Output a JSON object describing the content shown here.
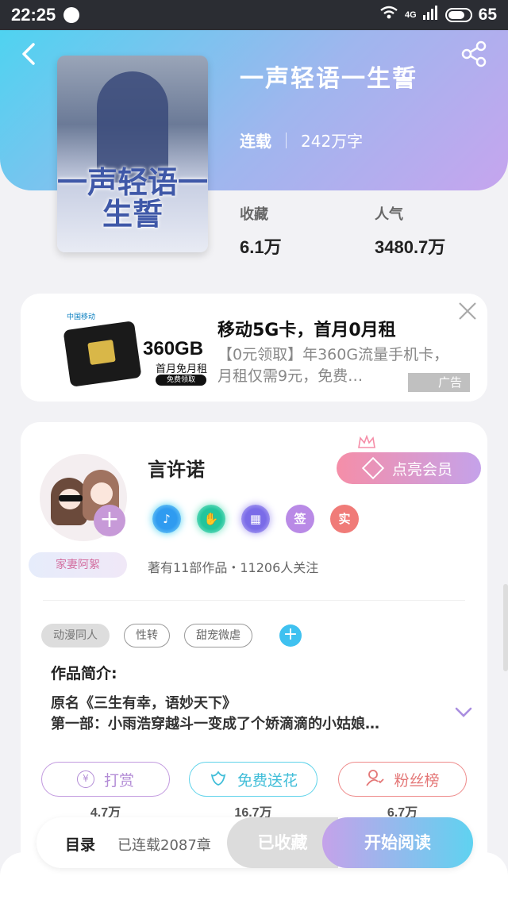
{
  "status_bar": {
    "time": "22:25",
    "network": "4G",
    "battery": "65"
  },
  "header": {
    "back_icon": "chevron-left-icon",
    "share_icon": "share-icon",
    "gradient": [
      "#4fd3f0",
      "#9fb6ee",
      "#c6a5ee"
    ]
  },
  "book": {
    "title": "一声轻语一生誓",
    "cover_title": "一声轻语一生誓",
    "status": "连载",
    "word_count": "242万字",
    "stats": [
      {
        "label": "收藏",
        "value": "6.1万"
      },
      {
        "label": "人气",
        "value": "3480.7万"
      }
    ]
  },
  "ad": {
    "image_logo": "中国移动",
    "image_gb": "360GB",
    "image_sub": "首月免月租",
    "image_pill": "免费领取",
    "title": "移动5G卡，首月0月租",
    "description": "【0元领取】年360G流量手机卡，月租仅需9元，免费…",
    "tag": "广告",
    "close_icon": "close-icon"
  },
  "author": {
    "name": "言许诺",
    "fan_tag": "家妻阿絮",
    "vip_label": "点亮会员",
    "badges": [
      {
        "icon": "music-note-icon",
        "text": ""
      },
      {
        "icon": "handshake-icon",
        "text": ""
      },
      {
        "icon": "calendar-icon",
        "text": ""
      },
      {
        "icon": "sign-badge",
        "text": "签"
      },
      {
        "icon": "real-badge",
        "text": "实"
      }
    ],
    "meta": "著有11部作品・11206人关注"
  },
  "tags": [
    "动漫同人",
    "性转",
    "甜宠微虐"
  ],
  "intro": {
    "label": "作品简介:",
    "text": "原名《三生有幸，语妙天下》\n第一部：小雨浩穿越斗一变成了个娇滴滴的小姑娘…"
  },
  "actions": [
    {
      "label": "打赏",
      "count": "4.7万",
      "icon": "yen-icon"
    },
    {
      "label": "免费送花",
      "count": "16.7万",
      "icon": "flower-icon"
    },
    {
      "label": "粉丝榜",
      "count": "6.7万",
      "icon": "fan-icon"
    }
  ],
  "bottom_bar": {
    "toc_label": "目录",
    "toc_meta": "已连载2087章",
    "favorite_label": "已收藏",
    "read_label": "开始阅读"
  }
}
